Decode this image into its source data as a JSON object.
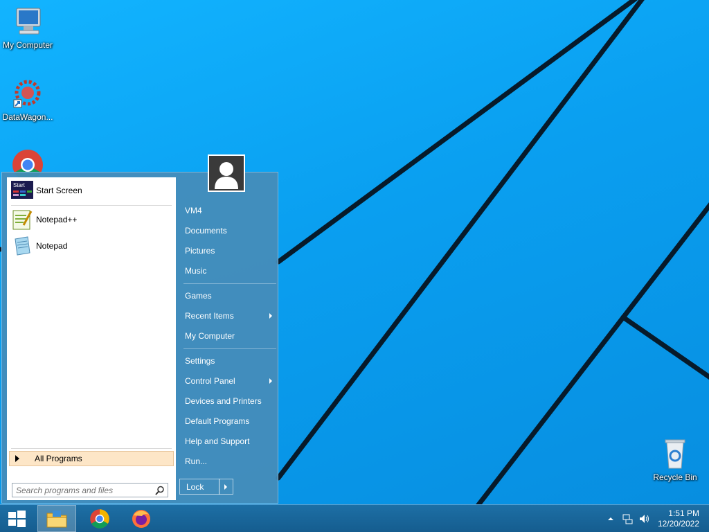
{
  "desktop": {
    "icons": [
      {
        "label": "My Computer",
        "icon": "computer-icon"
      },
      {
        "label": "DataWagon...",
        "icon": "datawagon-icon"
      },
      {
        "label": "Recycle Bin",
        "icon": "recycle-bin-icon"
      }
    ]
  },
  "start_menu": {
    "pinned": [
      {
        "label": "Start Screen",
        "icon": "start-screen-icon"
      },
      {
        "label": "Notepad++",
        "icon": "notepad-plus-plus-icon"
      },
      {
        "label": "Notepad",
        "icon": "notepad-icon"
      }
    ],
    "start_screen_badge": "Start",
    "all_programs": "All Programs",
    "search_placeholder": "Search programs and files",
    "right": {
      "user": "VM4",
      "documents": "Documents",
      "pictures": "Pictures",
      "music": "Music",
      "games": "Games",
      "recent_items": "Recent Items",
      "my_computer": "My Computer",
      "settings": "Settings",
      "control_panel": "Control Panel",
      "devices_printers": "Devices and Printers",
      "default_programs": "Default Programs",
      "help_support": "Help and Support",
      "run": "Run..."
    },
    "lock": "Lock"
  },
  "taskbar": {
    "pinned": [
      "file-explorer-icon",
      "chrome-icon",
      "firefox-icon"
    ],
    "clock_time": "1:51 PM",
    "clock_date": "12/20/2022"
  },
  "colors": {
    "wallpaper": "#0aa0ee",
    "taskbar": "#1a6699",
    "menu_panel": "#468cb9",
    "all_programs_highlight": "#fde6c7"
  }
}
